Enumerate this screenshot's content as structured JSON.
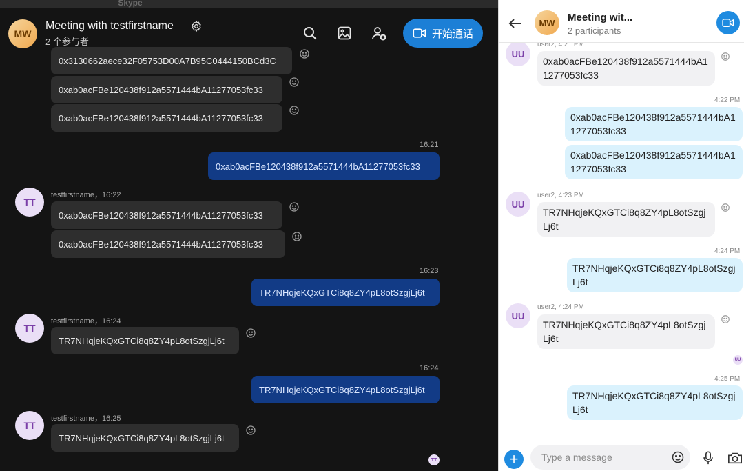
{
  "desktop": {
    "window_title": "Skype",
    "header": {
      "avatar_initials": "MW",
      "title": "Meeting with testfirstname",
      "subtitle": "2 个参与者",
      "call_button_label": "开始通话"
    },
    "messages": [
      {
        "id": "d0",
        "text": "0x3130662aece32F05753D00A7B95C0444150BCd3C"
      },
      {
        "id": "d1",
        "text": "0xab0acFBe120438f912a5571444bA11277053fc33"
      },
      {
        "id": "d2",
        "text": "0xab0acFBe120438f912a5571444bA11277053fc33"
      },
      {
        "id": "d3",
        "time": "16:21",
        "text": "0xab0acFBe120438f912a5571444bA11277053fc33"
      },
      {
        "id": "d4",
        "sender": "testfirstname，16:22",
        "avatar": "TT",
        "text": "0xab0acFBe120438f912a5571444bA11277053fc33"
      },
      {
        "id": "d5",
        "text": "0xab0acFBe120438f912a5571444bA11277053fc33"
      },
      {
        "id": "d6",
        "time": "16:23",
        "text": "TR7NHqjeKQxGTCi8q8ZY4pL8otSzgjLj6t"
      },
      {
        "id": "d7",
        "sender": "testfirstname，16:24",
        "avatar": "TT",
        "text": "TR7NHqjeKQxGTCi8q8ZY4pL8otSzgjLj6t"
      },
      {
        "id": "d8",
        "time": "16:24",
        "text": "TR7NHqjeKQxGTCi8q8ZY4pL8otSzgjLj6t"
      },
      {
        "id": "d9",
        "sender": "testfirstname，16:25",
        "avatar": "TT",
        "text": "TR7NHqjeKQxGTCi8q8ZY4pL8otSzgjLj6t"
      }
    ],
    "read_receipt_initials": "TT"
  },
  "mobile": {
    "header": {
      "avatar_initials": "MW",
      "title": "Meeting wit...",
      "subtitle": "2 participants"
    },
    "messages": [
      {
        "id": "m0",
        "sender": "user2, 4:21 PM",
        "avatar": "UU",
        "text": "0xab0acFBe120438f912a5571444bA11277053fc33"
      },
      {
        "id": "m1",
        "time": "4:22 PM",
        "text": "0xab0acFBe120438f912a5571444bA11277053fc33"
      },
      {
        "id": "m2",
        "text": "0xab0acFBe120438f912a5571444bA11277053fc33"
      },
      {
        "id": "m3",
        "sender": "user2, 4:23 PM",
        "avatar": "UU",
        "text": "TR7NHqjeKQxGTCi8q8ZY4pL8otSzgjLj6t"
      },
      {
        "id": "m4",
        "time": "4:24 PM",
        "text": "TR7NHqjeKQxGTCi8q8ZY4pL8otSzgjLj6t"
      },
      {
        "id": "m5",
        "sender": "user2, 4:24 PM",
        "avatar": "UU",
        "text": "TR7NHqjeKQxGTCi8q8ZY4pL8otSzgjLj6t"
      },
      {
        "id": "m6",
        "time": "4:25 PM",
        "text": "TR7NHqjeKQxGTCi8q8ZY4pL8otSzgjLj6t"
      }
    ],
    "read_receipt_initials": "UU",
    "composer_placeholder": "Type a message"
  },
  "colors": {
    "desktop_bg": "#141414",
    "desktop_incoming": "#2e2e2e",
    "desktop_outgoing": "#123b86",
    "accent_blue": "#1c7fd6",
    "mobile_incoming": "#f1f1f3",
    "mobile_outgoing": "#daf2fd"
  },
  "icons": [
    "settings-gear-icon",
    "search-icon",
    "gallery-icon",
    "add-person-icon",
    "video-call-icon",
    "smiley-icon",
    "back-arrow-icon",
    "plus-icon",
    "microphone-icon",
    "camera-icon"
  ]
}
